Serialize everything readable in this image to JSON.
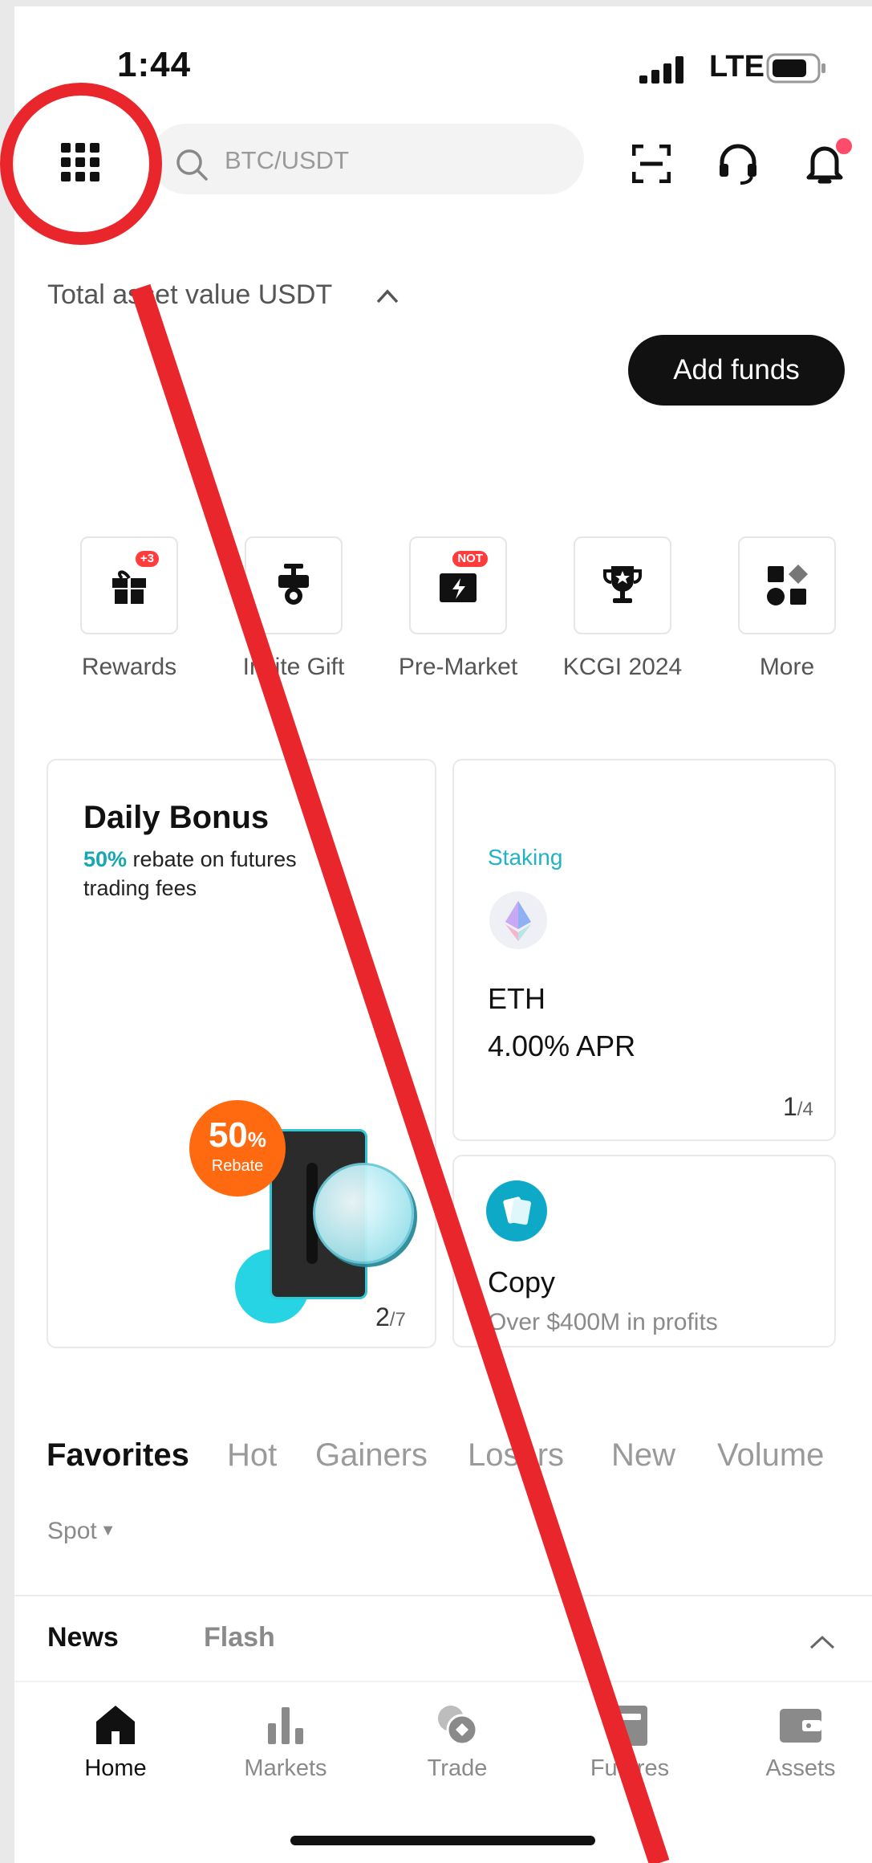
{
  "status_bar": {
    "time": "1:44",
    "network": "LTE"
  },
  "search": {
    "placeholder": "BTC/USDT"
  },
  "asset": {
    "label": "Total asset value USDT",
    "add_funds": "Add funds"
  },
  "quick_actions": [
    {
      "label": "Rewards",
      "badge": "+3",
      "icon": "gift-icon"
    },
    {
      "label": "Invite Gift",
      "icon": "medal-icon"
    },
    {
      "label": "Pre-Market",
      "badge": "NOT",
      "icon": "ticket-icon"
    },
    {
      "label": "KCGI 2024",
      "icon": "trophy-icon"
    },
    {
      "label": "More",
      "icon": "shapes-icon"
    }
  ],
  "daily_bonus": {
    "title": "Daily Bonus",
    "rebate_highlight": "50%",
    "rebate_text": " rebate on futures trading fees",
    "badge_value": "50",
    "badge_unit": "%",
    "badge_label": "Rebate",
    "page_current": "2",
    "page_total": "/7"
  },
  "staking": {
    "label": "Staking",
    "coin": "ETH",
    "apr": "4.00% APR",
    "page_current": "1",
    "page_total": "/4"
  },
  "copy": {
    "title": "Copy",
    "subtitle": "Over $400M in profits"
  },
  "market_tabs": [
    "Favorites",
    "Hot",
    "Gainers",
    "Losers",
    "New",
    "Volume"
  ],
  "spot_filter": "Spot",
  "news_tabs": {
    "news": "News",
    "flash": "Flash"
  },
  "bottom_nav": [
    "Home",
    "Markets",
    "Trade",
    "Futures",
    "Assets"
  ],
  "colors": {
    "accent": "#16a6b4",
    "annotation": "#e8262b",
    "primary_button": "#111111",
    "badge": "#ff3b3b"
  }
}
